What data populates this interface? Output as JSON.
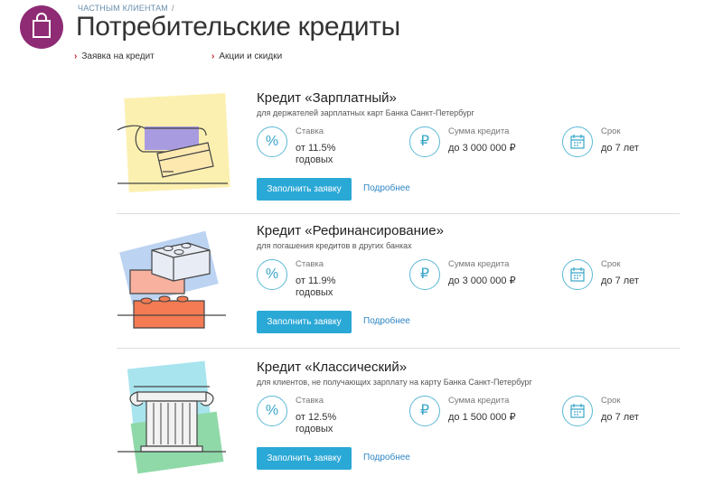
{
  "breadcrumb": {
    "items": [
      "ЧАСТНЫМ КЛИЕНТАМ"
    ],
    "separator": "/"
  },
  "page_title": "Потребительские кредиты",
  "subnav": [
    {
      "label": "Заявка на кредит"
    },
    {
      "label": "Акции и скидки"
    }
  ],
  "colors": {
    "brand": "#8e2b74",
    "accent": "#2aa8d6",
    "link": "#2f86c4",
    "chevron": "#c21f2a"
  },
  "products": [
    {
      "title": "Кредит «Зарплатный»",
      "subtitle": "для держателей зарплатных карт Банка Санкт-Петербург",
      "illustration": "wallet-card-icon",
      "features": [
        {
          "icon": "percent-icon",
          "label": "Ставка",
          "value_line1": "от 11.5%",
          "value_line2": "годовых"
        },
        {
          "icon": "ruble-icon",
          "label": "Сумма кредита",
          "value_line1": "до 3 000 000 ₽",
          "value_line2": ""
        },
        {
          "icon": "calendar-icon",
          "label": "Срок",
          "value_line1": "до 7 лет",
          "value_line2": ""
        }
      ],
      "apply_label": "Заполнить заявку",
      "more_label": "Подробнее"
    },
    {
      "title": "Кредит «Рефинансирование»",
      "subtitle": "для погашения кредитов в других банках",
      "illustration": "bricks-icon",
      "features": [
        {
          "icon": "percent-icon",
          "label": "Ставка",
          "value_line1": "от 11.9%",
          "value_line2": "годовых"
        },
        {
          "icon": "ruble-icon",
          "label": "Сумма кредита",
          "value_line1": "до 3 000 000 ₽",
          "value_line2": ""
        },
        {
          "icon": "calendar-icon",
          "label": "Срок",
          "value_line1": "до 7 лет",
          "value_line2": ""
        }
      ],
      "apply_label": "Заполнить заявку",
      "more_label": "Подробнее"
    },
    {
      "title": "Кредит «Классический»",
      "subtitle": "для клиентов, не получающих зарплату на карту Банка Санкт-Петербург",
      "illustration": "column-icon",
      "features": [
        {
          "icon": "percent-icon",
          "label": "Ставка",
          "value_line1": "от 12.5%",
          "value_line2": "годовых"
        },
        {
          "icon": "ruble-icon",
          "label": "Сумма кредита",
          "value_line1": "до 1 500 000 ₽",
          "value_line2": ""
        },
        {
          "icon": "calendar-icon",
          "label": "Срок",
          "value_line1": "до 7 лет",
          "value_line2": ""
        }
      ],
      "apply_label": "Заполнить заявку",
      "more_label": "Подробнее"
    }
  ]
}
